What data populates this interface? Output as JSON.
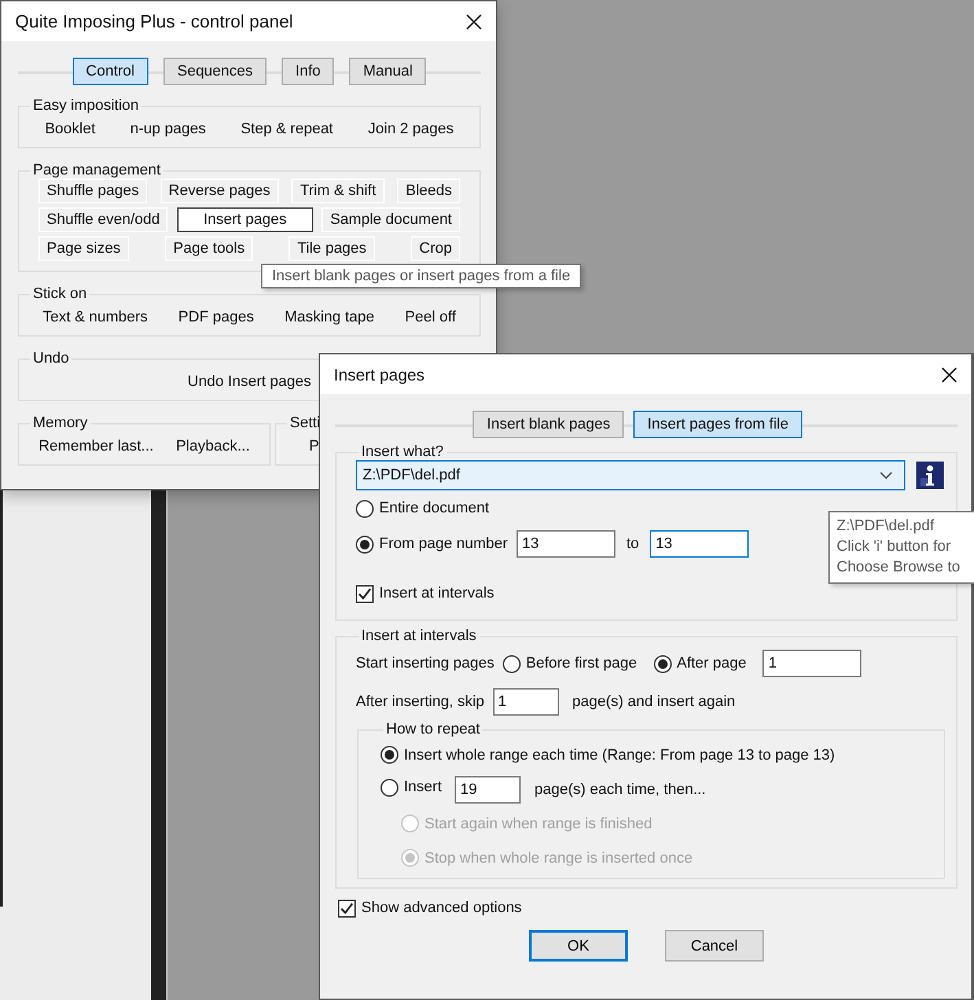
{
  "control_panel": {
    "title": "Quite Imposing Plus - control panel",
    "tabs": [
      {
        "label": "Control",
        "selected": true
      },
      {
        "label": "Sequences",
        "selected": false
      },
      {
        "label": "Info",
        "selected": false
      },
      {
        "label": "Manual",
        "selected": false
      }
    ],
    "groups": [
      {
        "label": "Easy imposition",
        "kind": "flat",
        "rows": [
          [
            {
              "label": "Booklet",
              "hovered": false
            },
            {
              "label": "n-up pages",
              "hovered": false
            },
            {
              "label": "Step & repeat",
              "hovered": false
            },
            {
              "label": "Join 2 pages",
              "hovered": false
            }
          ]
        ]
      },
      {
        "label": "Page management",
        "kind": "outlined",
        "rows": [
          [
            {
              "label": "Shuffle pages",
              "hovered": false
            },
            {
              "label": "Reverse pages",
              "hovered": false
            },
            {
              "label": "Trim & shift",
              "hovered": false
            },
            {
              "label": "Bleeds",
              "hovered": false
            }
          ],
          [
            {
              "label": "Shuffle even/odd",
              "hovered": false
            },
            {
              "label": "Insert pages",
              "hovered": true
            },
            {
              "label": "Sample document",
              "hovered": false
            }
          ],
          [
            {
              "label": "Page sizes",
              "hovered": false
            },
            {
              "label": "Page tools",
              "hovered": false
            },
            {
              "label": "Tile pages",
              "hovered": false
            },
            {
              "label": "Crop",
              "hovered": false
            }
          ]
        ]
      },
      {
        "label": "Stick on",
        "kind": "flat",
        "rows": [
          [
            {
              "label": "Text & numbers",
              "hovered": false
            },
            {
              "label": "PDF pages",
              "hovered": false
            },
            {
              "label": "Masking tape",
              "hovered": false
            },
            {
              "label": "Peel off",
              "hovered": false
            }
          ]
        ]
      },
      {
        "label": "Undo",
        "kind": "flat",
        "rows": [
          [
            {
              "label": "Undo Insert pages",
              "hovered": false
            }
          ]
        ]
      }
    ],
    "bottom_groups": [
      {
        "label": "Memory",
        "rows": [
          [
            {
              "label": "Remember last...",
              "hovered": false
            },
            {
              "label": "Playback...",
              "hovered": false
            }
          ]
        ]
      },
      {
        "label": "Setti",
        "rows": [
          [
            {
              "label": "P",
              "hovered": false
            }
          ]
        ]
      }
    ],
    "tooltip": "Insert blank pages or insert pages from a file"
  },
  "insert_dialog": {
    "title": "Insert pages",
    "tabs": [
      {
        "label": "Insert blank pages",
        "selected": false
      },
      {
        "label": "Insert pages from file",
        "selected": true
      }
    ],
    "insert_what": {
      "label": "Insert what?",
      "file": "Z:\\PDF\\del.pdf",
      "options": [
        {
          "label": "Entire document",
          "selected": false
        },
        {
          "label": "From page number",
          "selected": true
        }
      ],
      "from": {
        "value": "13",
        "focused": false
      },
      "to_label": "to",
      "to": {
        "value": "13",
        "focused": true
      },
      "intervals_checkbox": {
        "label": "Insert at intervals",
        "checked": true
      }
    },
    "intervals": {
      "label": "Insert at intervals",
      "start_label": "Start inserting pages",
      "start_options": [
        {
          "label": "Before first page",
          "selected": false
        },
        {
          "label": "After page",
          "selected": true
        }
      ],
      "after_page": {
        "value": "1",
        "focused": false
      },
      "skip_label": "After inserting, skip",
      "skip": {
        "value": "1",
        "focused": false
      },
      "skip_suffix": "page(s) and insert again",
      "repeat": {
        "label": "How to repeat",
        "options": [
          {
            "label": "Insert whole range each time (Range: From page 13 to page 13)",
            "selected": true
          },
          {
            "label": "Insert",
            "selected": false
          }
        ],
        "count": {
          "value": "19",
          "focused": false
        },
        "count_suffix": "page(s) each time, then...",
        "sub_options": [
          {
            "label": "Start again when range is finished",
            "selected": false,
            "disabled": true
          },
          {
            "label": "Stop when whole range is inserted once",
            "selected": true,
            "disabled": true
          }
        ]
      }
    },
    "advanced_checkbox": {
      "label": "Show advanced options",
      "checked": true
    },
    "buttons": [
      {
        "label": "OK",
        "default": true
      },
      {
        "label": "Cancel",
        "default": false
      }
    ],
    "tooltip": [
      "Z:\\PDF\\del.pdf",
      "Click 'i' button for",
      "Choose Browse to"
    ]
  }
}
